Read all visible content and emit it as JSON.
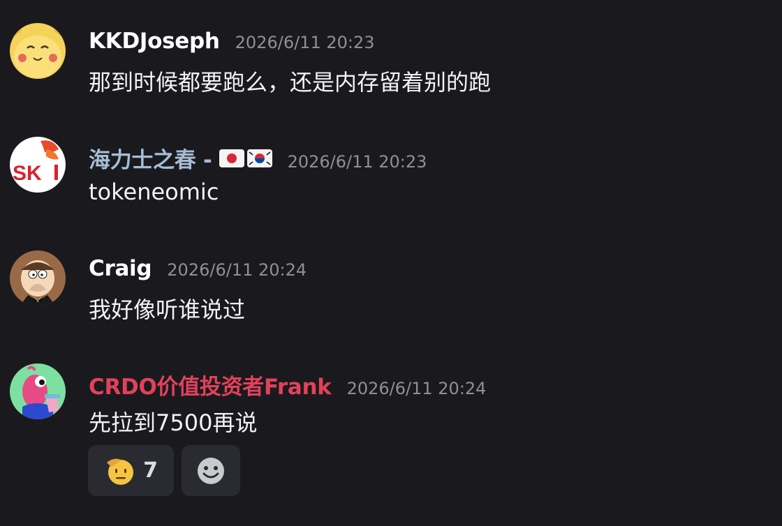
{
  "messages": [
    {
      "username": "KKDJoseph",
      "username_color": "#ffffff",
      "timestamp": "2026/6/11 20:23",
      "content": "那到时候都要跑么，还是内存留着别的跑",
      "avatar": "pikachu-avatar"
    },
    {
      "username": "海力士之春 -",
      "username_color": "#a7bdd6",
      "timestamp": "2026/6/11 20:23",
      "content": "tokeneomic",
      "avatar": "sk-hynix-avatar",
      "flags": [
        "japan-flag-icon",
        "south-korea-flag-icon"
      ]
    },
    {
      "username": "Craig",
      "username_color": "#ffffff",
      "timestamp": "2026/6/11 20:24",
      "content": "我好像听谁说过",
      "avatar": "peter-griffin-avatar"
    },
    {
      "username": "CRDO价值投资者Frank",
      "username_color": "#e2415a",
      "timestamp": "2026/6/11 20:24",
      "content": "先拉到7500再说",
      "avatar": "pink-creature-avatar"
    }
  ],
  "reactions": [
    {
      "icon": "saluting-face-icon",
      "count": "7"
    },
    {
      "icon": "add-reaction-icon",
      "count": ""
    }
  ]
}
